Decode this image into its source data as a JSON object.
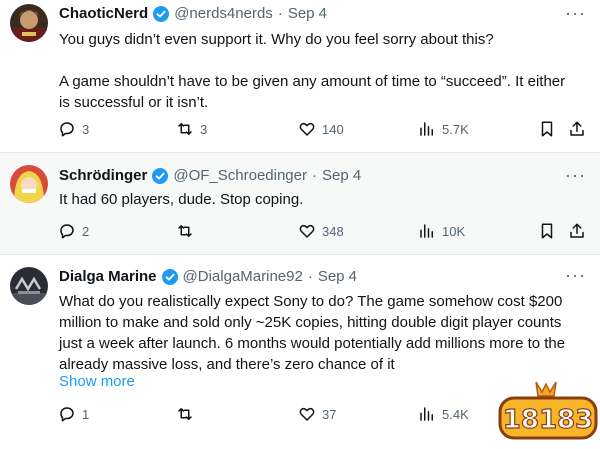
{
  "tweets": [
    {
      "name": "ChaoticNerd",
      "handle": "@nerds4nerds",
      "date": "Sep 4",
      "paragraphs": [
        "You guys didn’t even support it. Why do you feel sorry about this?",
        "A game shouldn’t have to be given any amount of time to “succeed”. It either is successful or it isn’t."
      ],
      "replies": "3",
      "reposts": "3",
      "likes": "140",
      "views": "5.7K"
    },
    {
      "name": "Schrödinger",
      "handle": "@OF_Schroedinger",
      "date": "Sep 4",
      "paragraphs": [
        "It had 60 players, dude. Stop coping."
      ],
      "replies": "2",
      "reposts": "",
      "likes": "348",
      "views": "10K"
    },
    {
      "name": "Dialga Marine",
      "handle": "@DialgaMarine92",
      "date": "Sep 4",
      "paragraphs": [
        "What do you realistically expect Sony to do? The game somehow cost $200 million to make and sold only ~25K copies, hitting double digit player counts just a week after launch. 6 months would potentially add millions more to the already massive loss, and there’s zero chance of it"
      ],
      "show_more": "Show more",
      "replies": "1",
      "reposts": "",
      "likes": "37",
      "views": "5.4K"
    }
  ],
  "more_glyph": "···",
  "separator_dot": "·",
  "watermark_text": "18183",
  "colors": {
    "verified": "#1d9bf0",
    "muted": "#536471",
    "link": "#1d9bf0",
    "hover_bg": "#f7f9f9"
  },
  "icons": [
    "verified-badge-icon",
    "reply-icon",
    "repost-icon",
    "like-icon",
    "views-icon",
    "bookmark-icon",
    "share-icon",
    "more-icon"
  ]
}
